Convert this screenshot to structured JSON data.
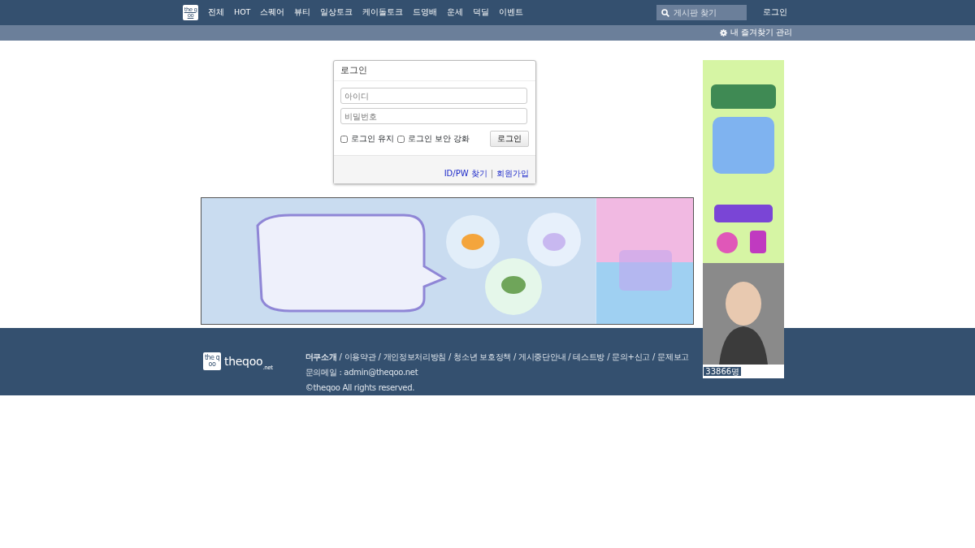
{
  "navbar": {
    "logo": "the qoo",
    "menu": [
      {
        "label": "전체"
      },
      {
        "label": "HOT"
      },
      {
        "label": "스퀘어"
      },
      {
        "label": "뷰티"
      },
      {
        "label": "일상토크"
      },
      {
        "label": "케이돌토크"
      },
      {
        "label": "드영배"
      },
      {
        "label": "운세"
      },
      {
        "label": "덕딜"
      },
      {
        "label": "이벤트"
      }
    ],
    "search": {
      "placeholder": "게시판 찾기"
    },
    "login": "로그인"
  },
  "subbar": {
    "favorites": "내 즐겨찾기 관리"
  },
  "login_box": {
    "title": "로그인",
    "id_field": {
      "placeholder": "아이디"
    },
    "password_field": {
      "placeholder": "비밀번호"
    },
    "options": [
      {
        "label": "로그인 유지",
        "checked": false
      },
      {
        "label": "로그인 보안 강화",
        "checked": false
      }
    ],
    "button": "로그인",
    "links": [
      {
        "label": "ID/PW 찾기"
      },
      {
        "label": "회원가입"
      }
    ],
    "link_separator": "|"
  },
  "side_ad": {
    "kind": "picture",
    "counter": "33866명"
  },
  "footer": {
    "logo": "the qoo",
    "wordmark": "theqoo",
    "wordmark_sub": ".net",
    "link_separator": "/",
    "links": [
      {
        "label": "더쿠소개",
        "bold": true
      },
      {
        "label": "이용약관",
        "bold": false
      },
      {
        "label": "개인정보처리방침",
        "bold": false
      },
      {
        "label": "청소년 보호정책",
        "bold": false
      },
      {
        "label": "게시중단안내",
        "bold": false
      },
      {
        "label": "테스트방",
        "bold": false
      },
      {
        "label": "문의+신고",
        "bold": false
      },
      {
        "label": "문제보고",
        "bold": false
      }
    ],
    "email": "문의메일 : admin@theqoo.net",
    "copyright": "©theqoo All rights reserved."
  }
}
